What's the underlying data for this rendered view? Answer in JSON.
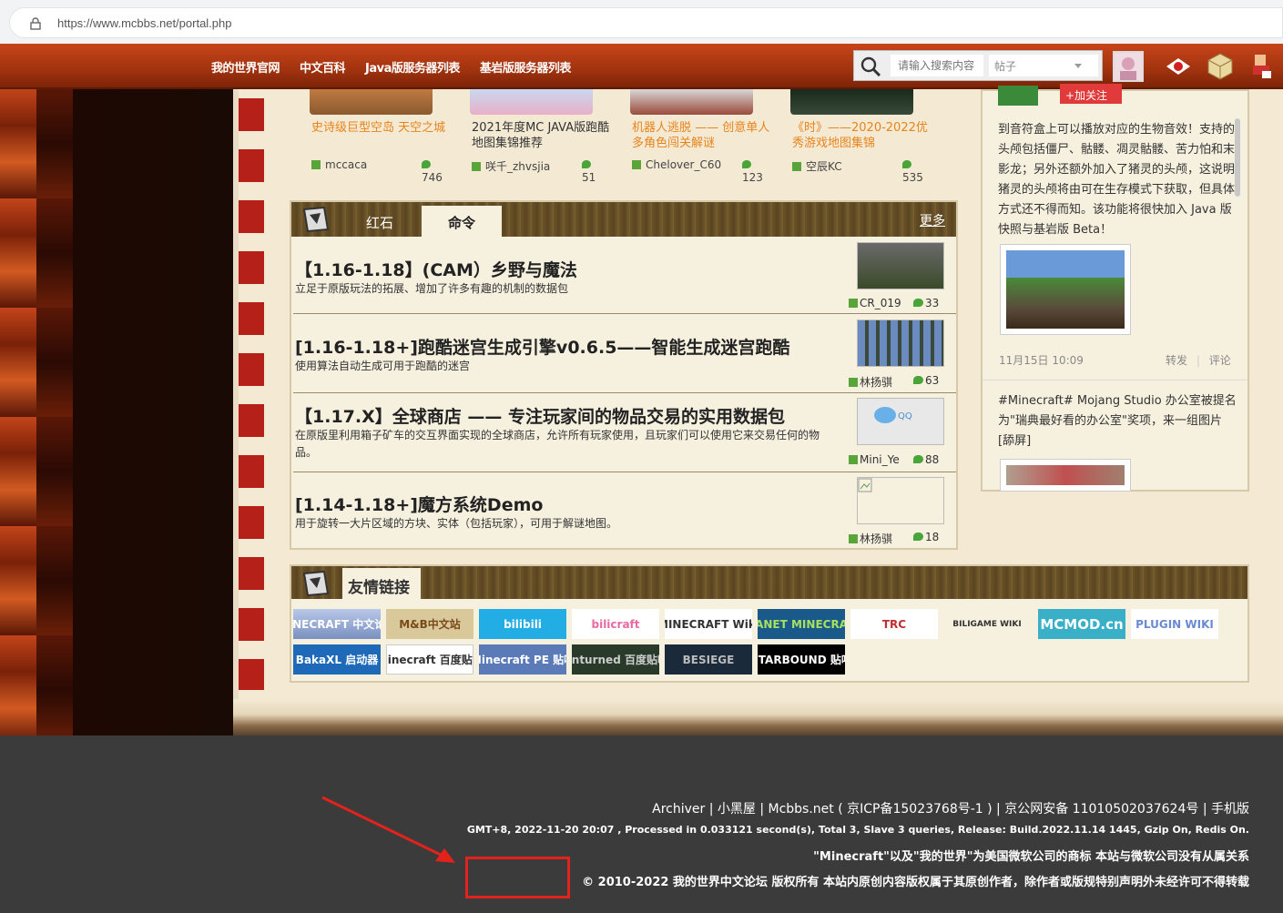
{
  "browser": {
    "url": "https://www.mcbbs.net/portal.php"
  },
  "nav": {
    "links": [
      "我的世界官网",
      "中文百科",
      "Java版服务器列表",
      "基岩版服务器列表"
    ],
    "search_placeholder": "请输入搜索内容",
    "search_scope": "帖子"
  },
  "top_cards": [
    {
      "title": "史诗级巨型空岛 天空之城",
      "author": "mccaca",
      "comments": "746"
    },
    {
      "title": "2021年度MC JAVA版跑酷地图集锦推荐",
      "author": "咲千_zhvsjia",
      "comments": "51"
    },
    {
      "title": "机器人逃脱 —— 创意单人多角色闯关解谜",
      "author": "Chelover_C60",
      "comments": "123"
    },
    {
      "title": "《时》——2020-2022优秀游戏地图集锦",
      "author": "空辰KC",
      "comments": "535"
    }
  ],
  "posts_panel": {
    "tabs": [
      "红石",
      "命令"
    ],
    "active_tab": "命令",
    "more": "更多",
    "posts": [
      {
        "title": "【1.16-1.18】(CAM）乡野与魔法",
        "desc": "立足于原版玩法的拓展、增加了许多有趣的机制的数据包",
        "author": "CR_019",
        "comments": "33"
      },
      {
        "title": "[1.16-1.18+]跑酷迷宫生成引擎v0.6.5——智能生成迷宫跑酷",
        "desc": "使用算法自动生成可用于跑酷的迷宫",
        "author": "林扬骐",
        "comments": "63"
      },
      {
        "title": "【1.17.X】全球商店 —— 专注玩家间的物品交易的实用数据包",
        "desc": "在原版里利用箱子矿车的交互界面实现的全球商店，允许所有玩家使用，且玩家们可以使用它来交易任何的物品。",
        "author": "Mini_Ye",
        "comments": "88"
      },
      {
        "title": "[1.14-1.18+]魔方系统Demo",
        "desc": "用于旋转一大片区域的方块、实体（包括玩家），可用于解谜地图。",
        "author": "林扬骐",
        "comments": "18"
      }
    ]
  },
  "weibo": {
    "follow": "+加关注",
    "post1": "到音符盒上可以播放对应的生物音效！支持的头颅包括僵尸、骷髅、凋灵骷髅、苦力怕和末影龙；另外还额外加入了猪灵的头颅，这说明猪灵的头颅将由可在生存模式下获取，但具体方式还不得而知。该功能将很快加入 Java 版快照与基岩版 Beta！",
    "time": "11月15日 10:09",
    "forward": "转发",
    "comment": "评论",
    "post2": "#Minecraft# Mojang Studio 办公室被提名为\"瑞典最好看的办公室\"奖项，来一组图片[舔屏]"
  },
  "friends": {
    "title": "友情链接",
    "links": [
      "MINECRAFT 中文论坛",
      "M&B中文站",
      "bilibili",
      "bilicraft",
      "MINECRAFT Wiki",
      "PLANET MINECRAFT",
      "TRC",
      "BILIGAME WIKI",
      "MCMOD.cn",
      "PLUGIN WIKI",
      "BakaXL 启动器",
      "minecraft 百度贴吧",
      "Minecraft PE 贴吧",
      "Unturned 百度贴吧",
      "BESIEGE",
      "STARBOUND 贴吧"
    ]
  },
  "footer": {
    "line1": "Archiver | 小黑屋 | Mcbbs.net ( 京ICP备15023768号-1 ) | 京公网安备 11010502037624号 | 手机版",
    "line2": "GMT+8, 2022-11-20 20:07 , Processed in 0.033121 second(s), Total 3, Slave 3 queries, Release: Build.2022.11.14 1445, Gzip On, Redis On.",
    "line3": "\"Minecraft\"以及\"我的世界\"为美国微软公司的商标 本站与微软公司没有从属关系",
    "line4": "© 2010-2022 我的世界中文论坛 版权所有 本站内原创内容版权属于其原创作者，除作者或版规特别声明外未经许可不得转载"
  },
  "colors": {
    "nav": "#a1330f",
    "accent_orange": "#e8831b",
    "annotation_red": "#e3221c",
    "page": "#f4ead4"
  }
}
